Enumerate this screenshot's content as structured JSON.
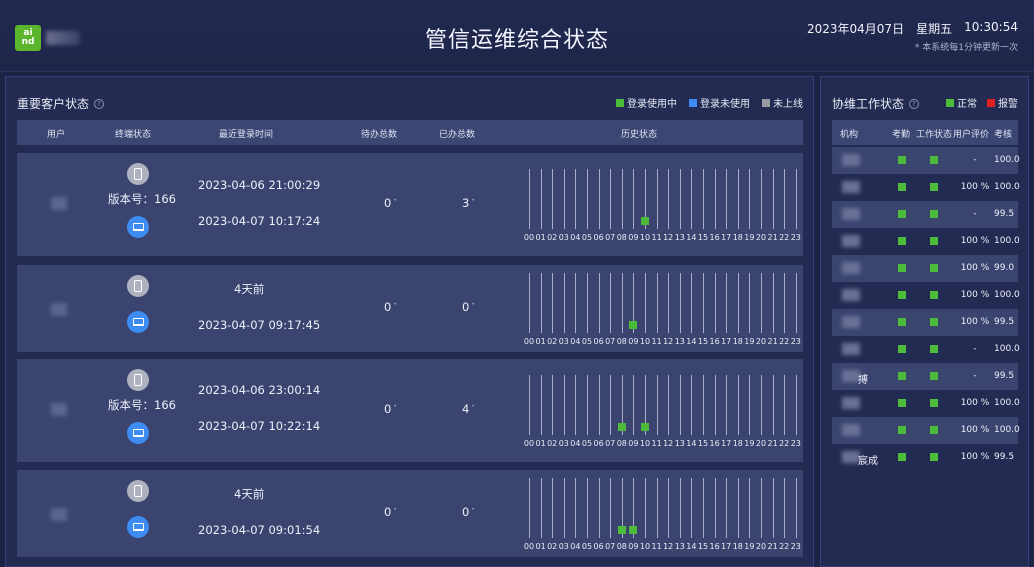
{
  "header": {
    "logo_top": "ai",
    "logo_bottom": "nd",
    "title": "管信运维综合状态",
    "date": "2023年04月07日",
    "weekday": "星期五",
    "clock": "10:30:54",
    "update_note": "* 本系统每1分钟更新一次"
  },
  "colors": {
    "online": "#4dbb3a",
    "idle": "#3d8cf2",
    "offline": "#9a9aa2",
    "alarm": "#e02020",
    "background": "#1d2346"
  },
  "customers": {
    "title": "重要客户状态",
    "help_icon": "?",
    "legend": [
      {
        "label": "登录使用中",
        "color": "#4dbb3a"
      },
      {
        "label": "登录未使用",
        "color": "#3d8cf2"
      },
      {
        "label": "未上线",
        "color": "#9a9aa2"
      }
    ],
    "columns": [
      "用户",
      "终端状态",
      "最近登录时间",
      "待办总数",
      "已办总数",
      "历史状态"
    ],
    "hours": [
      "00",
      "01",
      "02",
      "03",
      "04",
      "05",
      "06",
      "07",
      "08",
      "09",
      "10",
      "11",
      "12",
      "13",
      "14",
      "15",
      "16",
      "17",
      "18",
      "19",
      "20",
      "21",
      "22",
      "23"
    ],
    "rows": [
      {
        "version": "版本号：166",
        "time1": "2023-04-06 21:00:29",
        "time2": "2023-04-07 10:17:24",
        "todo": "0",
        "done": "3",
        "active_hours": [
          10
        ]
      },
      {
        "version": "",
        "time1": "4天前",
        "time2": "2023-04-07 09:17:45",
        "todo": "0",
        "done": "0",
        "active_hours": [
          9
        ]
      },
      {
        "version": "版本号：166",
        "time1": "2023-04-06 23:00:14",
        "time2": "2023-04-07 10:22:14",
        "todo": "0",
        "done": "4",
        "active_hours": [
          8,
          10
        ]
      },
      {
        "version": "",
        "time1": "4天前",
        "time2": "2023-04-07 09:01:54",
        "todo": "0",
        "done": "0",
        "active_hours": [
          8,
          9
        ]
      }
    ]
  },
  "collab": {
    "title": "协维工作状态",
    "help_icon": "?",
    "legend": [
      {
        "label": "正常",
        "color": "#4dbb3a"
      },
      {
        "label": "报警",
        "color": "#e02020"
      }
    ],
    "columns": [
      "机构",
      "考勤",
      "工作状态",
      "用户评价",
      "考核"
    ],
    "rows": [
      {
        "org": "",
        "rating": "-",
        "score": "100.0"
      },
      {
        "org": "",
        "rating": "100 %",
        "score": "100.0"
      },
      {
        "org": "",
        "rating": "-",
        "score": "99.5"
      },
      {
        "org": "",
        "rating": "100 %",
        "score": "100.0"
      },
      {
        "org": "",
        "rating": "100 %",
        "score": "99.0"
      },
      {
        "org": "",
        "rating": "100 %",
        "score": "100.0"
      },
      {
        "org": "",
        "rating": "100 %",
        "score": "99.5"
      },
      {
        "org": "",
        "rating": "-",
        "score": "100.0"
      },
      {
        "org": "搏",
        "rating": "-",
        "score": "99.5"
      },
      {
        "org": "",
        "rating": "100 %",
        "score": "100.0"
      },
      {
        "org": "",
        "rating": "100 %",
        "score": "100.0"
      },
      {
        "org": "宸成",
        "rating": "100 %",
        "score": "99.5"
      }
    ]
  }
}
